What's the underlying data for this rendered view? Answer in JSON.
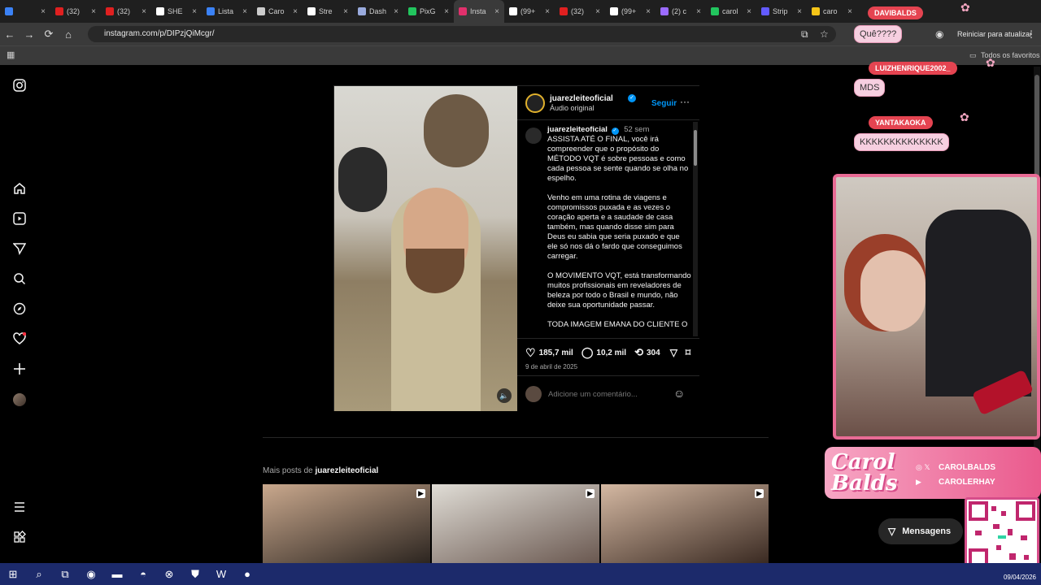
{
  "browser": {
    "tabs": [
      {
        "label": "",
        "color": "#3b82f6"
      },
      {
        "label": "(32)",
        "color": "#e02020"
      },
      {
        "label": "(32)",
        "color": "#e02020"
      },
      {
        "label": "SHE",
        "color": "#ffffff"
      },
      {
        "label": "Lista",
        "color": "#3b82f6"
      },
      {
        "label": "Caro",
        "color": "#cccccc"
      },
      {
        "label": "Stre",
        "color": "#ffffff"
      },
      {
        "label": "Dash",
        "color": "#9ad"
      },
      {
        "label": "PixG",
        "color": "#22c55e"
      },
      {
        "label": "Insta",
        "color": "#e1306c"
      },
      {
        "label": "(99+",
        "color": "#ffffff"
      },
      {
        "label": "(32)",
        "color": "#e02020"
      },
      {
        "label": "(99+",
        "color": "#ffffff"
      },
      {
        "label": "(2) c",
        "color": "#9b6bff"
      },
      {
        "label": "carol",
        "color": "#22c55e"
      },
      {
        "label": "Strip",
        "color": "#635bff"
      },
      {
        "label": "caro",
        "color": "#f5c518"
      }
    ],
    "active_tab_index": 9,
    "url": "instagram.com/p/DIPzjQiMcgr/",
    "restart_button": "Reiniciar para atualizar",
    "bookmarks_label": "Todos os favoritos"
  },
  "post": {
    "author": "juarezleiteoficial",
    "audio": "Áudio original",
    "follow": "Seguir",
    "caption_author": "juarezleiteoficial",
    "caption_time": "52 sem",
    "caption_paragraphs": [
      "ASSISTA ATÉ O FINAL, você irá compreender que o propósito do MÉTODO VQT é sobre pessoas e como cada pessoa se sente quando se olha no espelho.",
      "Venho em uma rotina de viagens e compromissos puxada e as vezes o coração aperta e a saudade de casa também, mas quando disse sim para Deus eu sabia que seria puxado e que ele só nos dá o fardo que conseguimos carregar.",
      "O MOVIMENTO VQT, está transformando muitos profissionais em reveladores de beleza por todo o Brasil e mundo, não deixe sua oportunidade passar.",
      "TODA IMAGEM EMANA DO CLIENTE O"
    ],
    "likes": "185,7 mil",
    "comments": "10,2 mil",
    "reposts": "304",
    "date": "9 de abril de 2025",
    "comment_placeholder": "Adicione um comentário..."
  },
  "more_posts": {
    "prefix": "Mais posts de",
    "author": "juarezleiteoficial"
  },
  "messages_button": "Mensagens",
  "overlay": {
    "chat": [
      {
        "user": "DAVIBALDS",
        "message": "Quê????"
      },
      {
        "user": "LUIZHENRIQUE2002_",
        "message": "MDS"
      },
      {
        "user": "YANTAKAOKA",
        "message": "KKKKKKKKKKKKKK"
      }
    ],
    "banner_name": "Carol Balds",
    "social_1": "CAROLBALDS",
    "social_2": "CAROLERHAY"
  },
  "taskbar": {
    "date": "09/04/2026"
  }
}
